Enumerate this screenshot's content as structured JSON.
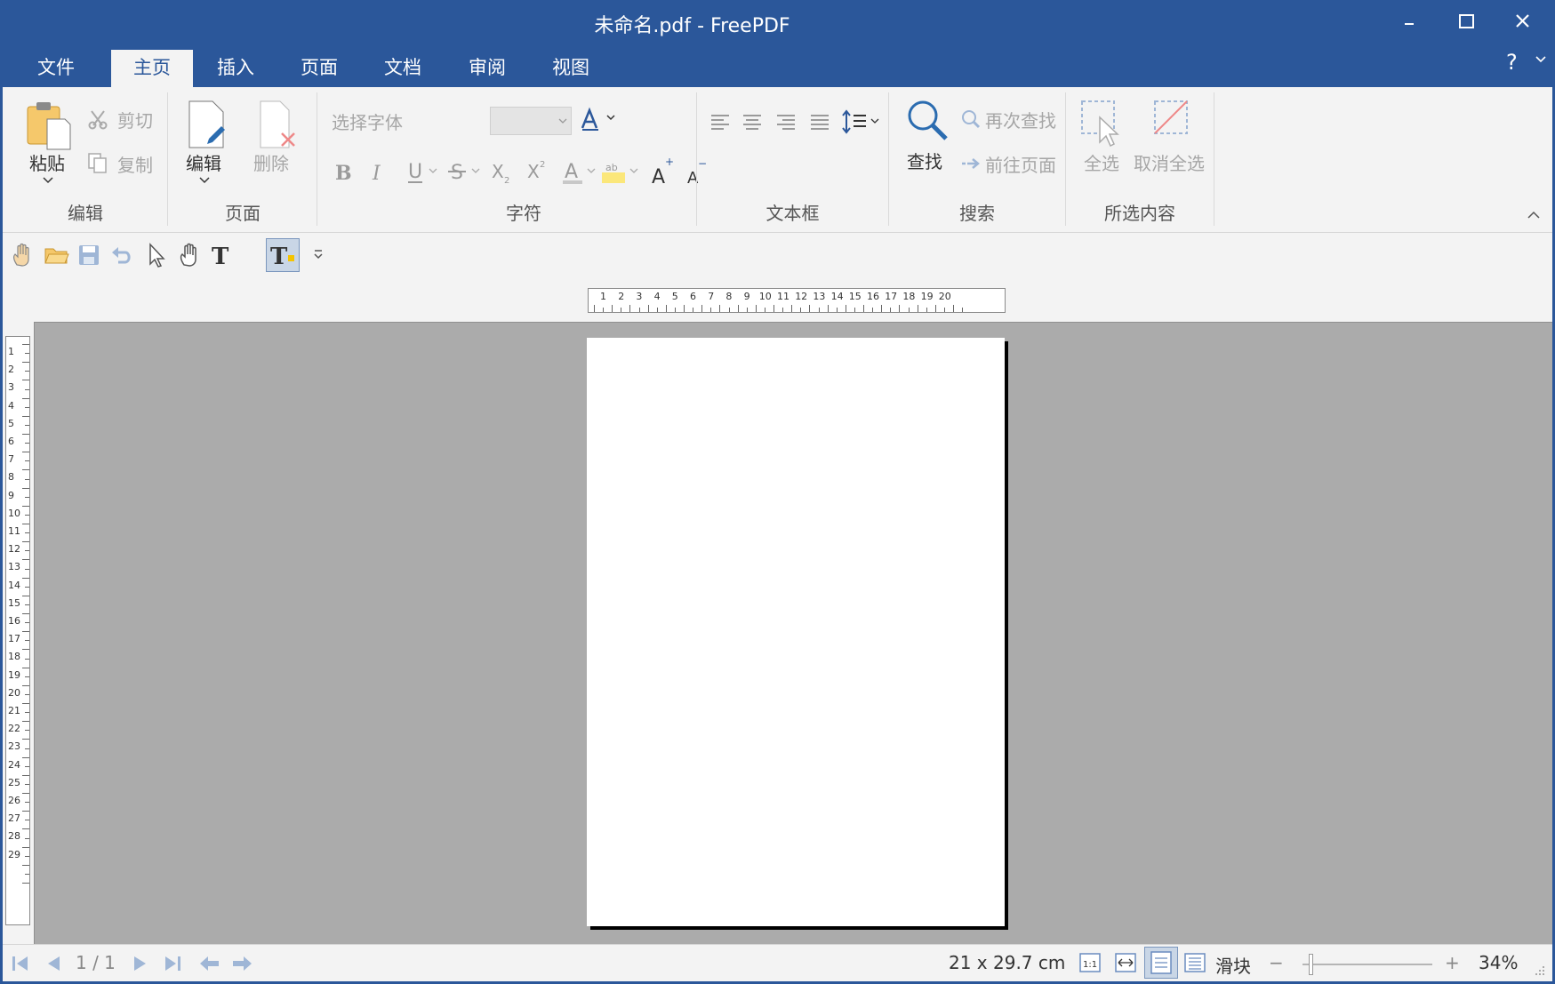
{
  "window": {
    "title": "未命名.pdf - FreePDF"
  },
  "menu": {
    "tabs": [
      {
        "label": "文件"
      },
      {
        "label": "主页",
        "active": true
      },
      {
        "label": "插入"
      },
      {
        "label": "页面"
      },
      {
        "label": "文档"
      },
      {
        "label": "审阅"
      },
      {
        "label": "视图"
      }
    ],
    "help": "?"
  },
  "ribbon": {
    "edit_group": {
      "label": "编辑",
      "paste": "粘贴",
      "cut": "剪切",
      "copy": "复制"
    },
    "page_group": {
      "label": "页面",
      "edit": "编辑",
      "delete": "删除"
    },
    "char_group": {
      "label": "字符",
      "font_placeholder": "选择字体",
      "font_size": ""
    },
    "textbox_group": {
      "label": "文本框"
    },
    "search_group": {
      "label": "搜索",
      "find": "查找",
      "find_again": "再次查找",
      "goto_page": "前往页面"
    },
    "selection_group": {
      "label": "所选内容",
      "select_all": "全选",
      "deselect_all": "取消全选"
    }
  },
  "rulers": {
    "horizontal": [
      "1",
      "2",
      "3",
      "4",
      "5",
      "6",
      "7",
      "8",
      "9",
      "10",
      "11",
      "12",
      "13",
      "14",
      "15",
      "16",
      "17",
      "18",
      "19",
      "20"
    ],
    "vertical": [
      "1",
      "2",
      "3",
      "4",
      "5",
      "6",
      "7",
      "8",
      "9",
      "10",
      "11",
      "12",
      "13",
      "14",
      "15",
      "16",
      "17",
      "18",
      "19",
      "20",
      "21",
      "22",
      "23",
      "24",
      "25",
      "26",
      "27",
      "28",
      "29"
    ]
  },
  "status": {
    "page": "1 / 1",
    "page_size": "21 x 29.7 cm",
    "zoom_mode": "滑块",
    "zoom_minus": "−",
    "zoom_plus": "+",
    "zoom": "34%",
    "zoom_level": 0.34
  },
  "colors": {
    "accent": "#2b579a",
    "ribbon_bg": "#f3f3f3",
    "canvas_bg": "#ababab"
  }
}
